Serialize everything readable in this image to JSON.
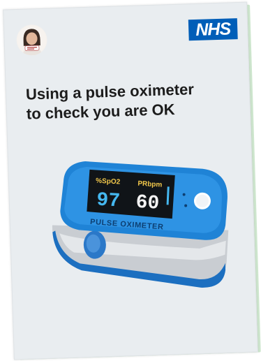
{
  "brand": {
    "logo_text": "NHS",
    "logo_color": "#005eb8"
  },
  "title": {
    "line1": "Using a pulse oximeter",
    "line2": "to check you are OK"
  },
  "device": {
    "spo2_label": "%SpO2",
    "pr_label": "PRbpm",
    "spo2_value": "97",
    "pr_value": "60",
    "device_label": "PULSE OXIMETER",
    "body_color": "#1e7fd0",
    "screen_color": "#101418"
  }
}
